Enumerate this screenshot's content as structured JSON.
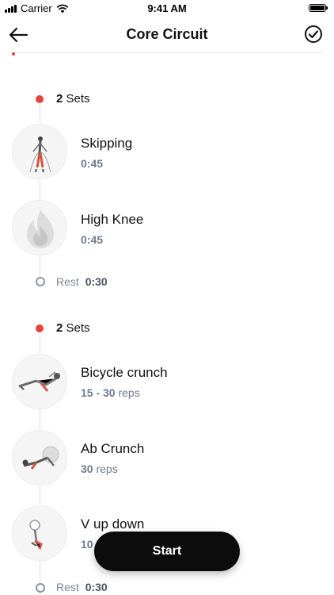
{
  "status_bar": {
    "carrier": "Carrier",
    "time": "9:41 AM"
  },
  "nav": {
    "title": "Core Circuit",
    "back_icon": "back-arrow-icon",
    "done_icon": "check-circle-icon"
  },
  "blocks": [
    {
      "sets_count": "2",
      "sets_label": "Sets",
      "exercises": [
        {
          "name": "Skipping",
          "detail": "0:45",
          "unit": ""
        },
        {
          "name": "High Knee",
          "detail": "0:45",
          "unit": ""
        }
      ],
      "rest_label": "Rest",
      "rest_time": "0:30"
    },
    {
      "sets_count": "2",
      "sets_label": "Sets",
      "exercises": [
        {
          "name": "Bicycle crunch",
          "detail": "15 - 30",
          "unit": "reps"
        },
        {
          "name": "Ab Crunch",
          "detail": "30",
          "unit": "reps"
        },
        {
          "name": "V up down",
          "detail": "10",
          "unit": ""
        }
      ],
      "rest_label": "Rest",
      "rest_time": "0:30"
    }
  ],
  "start_button": {
    "label": "Start"
  },
  "colors": {
    "accent_red": "#e3453a",
    "detail_gray": "#6e7b8d",
    "button_black": "#0c0c0c"
  }
}
